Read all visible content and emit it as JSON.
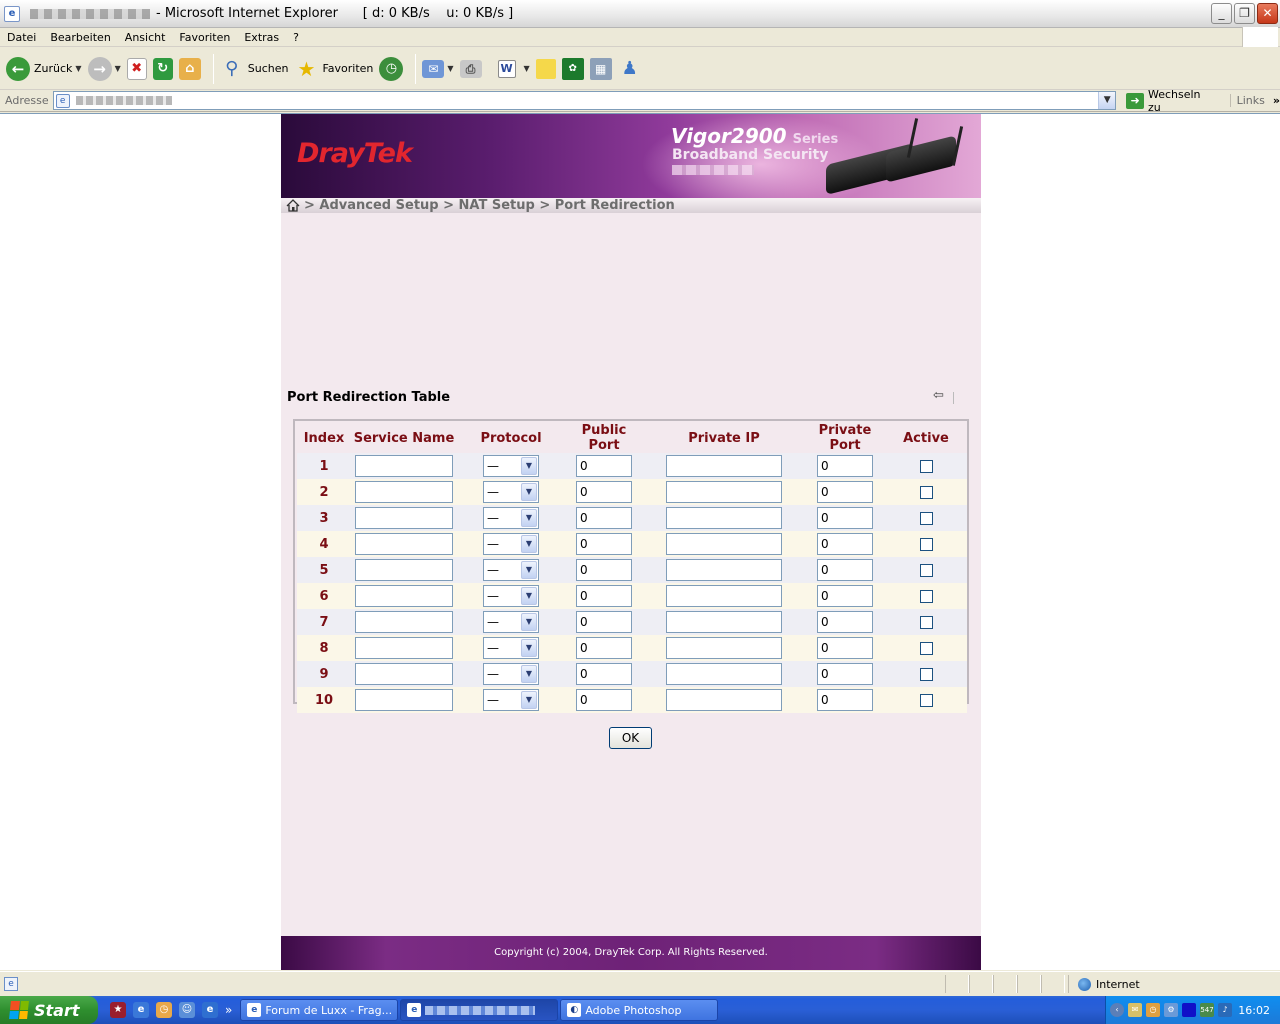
{
  "window": {
    "title": "- Microsoft Internet Explorer      [ d: 0 KB/s    u: 0 KB/s ]"
  },
  "menubar": {
    "items": [
      "Datei",
      "Bearbeiten",
      "Ansicht",
      "Favoriten",
      "Extras",
      "?"
    ]
  },
  "toolbar": {
    "back_label": "Zurück",
    "search_label": "Suchen",
    "favorites_label": "Favoriten"
  },
  "addressbar": {
    "label": "Adresse",
    "go_label": "Wechseln zu",
    "links_label": "Links"
  },
  "page": {
    "brand": "DrayTek",
    "model": "Vigor2900",
    "series": "Series",
    "tagline": "Broadband Security",
    "breadcrumb": "> Advanced Setup > NAT Setup > Port Redirection",
    "table_title": "Port Redirection Table",
    "columns": [
      "Index",
      "Service Name",
      "Protocol",
      "Public Port",
      "Private IP",
      "Private Port",
      "Active"
    ],
    "rows": [
      {
        "index": "1",
        "service": "",
        "protocol": "—",
        "public_port": "0",
        "private_ip": "",
        "private_port": "0",
        "active": false
      },
      {
        "index": "2",
        "service": "",
        "protocol": "—",
        "public_port": "0",
        "private_ip": "",
        "private_port": "0",
        "active": false
      },
      {
        "index": "3",
        "service": "",
        "protocol": "—",
        "public_port": "0",
        "private_ip": "",
        "private_port": "0",
        "active": false
      },
      {
        "index": "4",
        "service": "",
        "protocol": "—",
        "public_port": "0",
        "private_ip": "",
        "private_port": "0",
        "active": false
      },
      {
        "index": "5",
        "service": "",
        "protocol": "—",
        "public_port": "0",
        "private_ip": "",
        "private_port": "0",
        "active": false
      },
      {
        "index": "6",
        "service": "",
        "protocol": "—",
        "public_port": "0",
        "private_ip": "",
        "private_port": "0",
        "active": false
      },
      {
        "index": "7",
        "service": "",
        "protocol": "—",
        "public_port": "0",
        "private_ip": "",
        "private_port": "0",
        "active": false
      },
      {
        "index": "8",
        "service": "",
        "protocol": "—",
        "public_port": "0",
        "private_ip": "",
        "private_port": "0",
        "active": false
      },
      {
        "index": "9",
        "service": "",
        "protocol": "—",
        "public_port": "0",
        "private_ip": "",
        "private_port": "0",
        "active": false
      },
      {
        "index": "10",
        "service": "",
        "protocol": "—",
        "public_port": "0",
        "private_ip": "",
        "private_port": "0",
        "active": false
      }
    ],
    "ok_label": "OK",
    "copyright": "Copyright (c) 2004, DrayTek Corp. All Rights Reserved."
  },
  "statusbar": {
    "zone": "Internet"
  },
  "taskbar": {
    "start_label": "Start",
    "tasks": [
      "Forum de Luxx - Frag...",
      "",
      "Adobe Photoshop"
    ],
    "tray_small": "547",
    "clock": "16:02"
  },
  "colors": {
    "header_text": "#7a0e14",
    "brand_red": "#e2262e",
    "page_bg": "#f3e9ee"
  }
}
